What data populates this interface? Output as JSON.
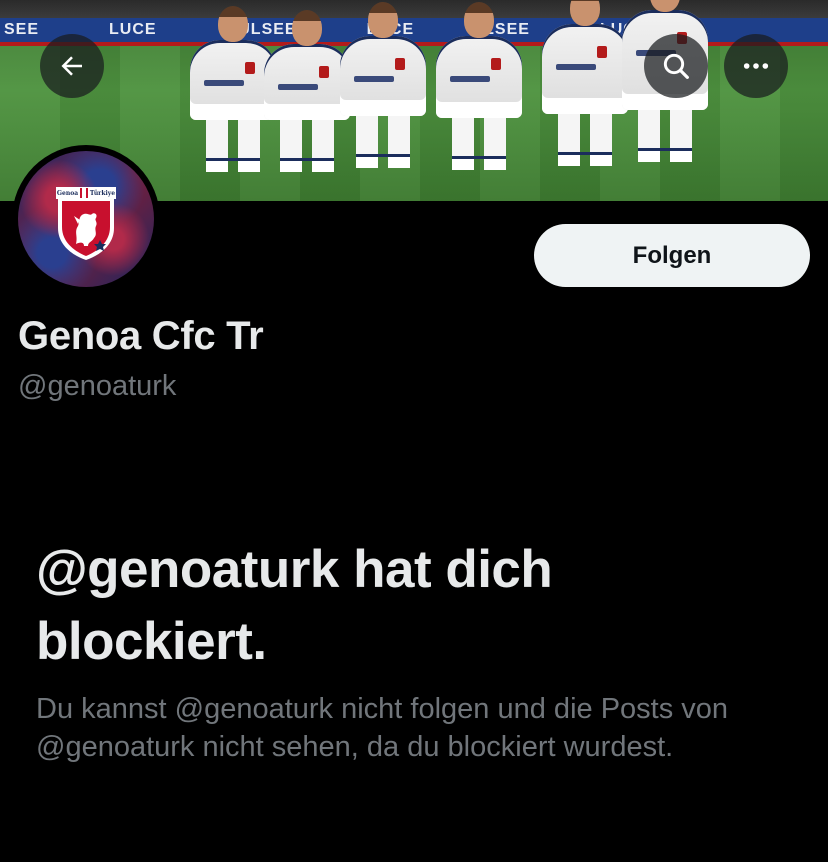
{
  "banner": {
    "ad_texts": [
      "SEE",
      "LUCE",
      "PULSEE",
      "LUCE",
      "LSEE",
      "LUCE"
    ]
  },
  "header": {
    "back_icon": "arrow-left-icon",
    "search_icon": "search-icon",
    "more_icon": "more-horizontal-icon"
  },
  "profile": {
    "avatar_badge_left": "Genoa",
    "avatar_badge_right": "Türkiye",
    "display_name": "Genoa Cfc Tr",
    "handle": "@genoaturk",
    "follow_label": "Folgen"
  },
  "blocked": {
    "title": "@genoaturk hat dich blockiert.",
    "description": "Du kannst @genoaturk nicht folgen und die Posts von @genoaturk nicht sehen, da du blockiert wurdest."
  },
  "colors": {
    "background": "#000000",
    "primary_text": "#e7e9ea",
    "secondary_text": "#71767b",
    "follow_button_bg": "#eff3f4",
    "follow_button_text": "#0f1419"
  }
}
